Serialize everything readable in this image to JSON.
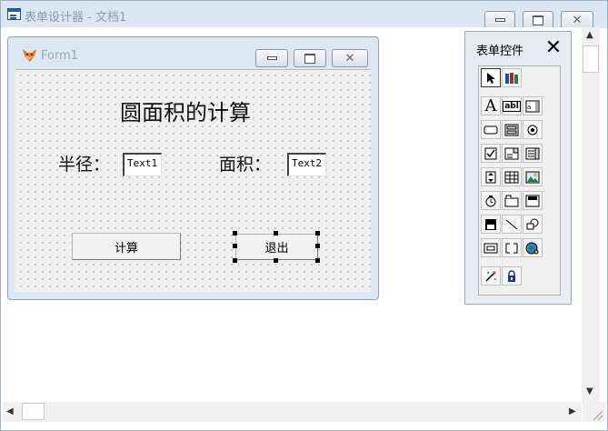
{
  "window": {
    "title": "表单设计器 - 文档1"
  },
  "form": {
    "title": "Form1",
    "heading": "圆面积的计算",
    "radius_label": "半径：",
    "area_label": "面积：",
    "text1": "Text1",
    "text2": "Text2",
    "calc_button": "计算",
    "exit_button": "退出"
  },
  "toolbox": {
    "title": "表单控件",
    "close": "✕",
    "label_tool_glyph": "A",
    "textbox_tool_glyph": "abl"
  }
}
